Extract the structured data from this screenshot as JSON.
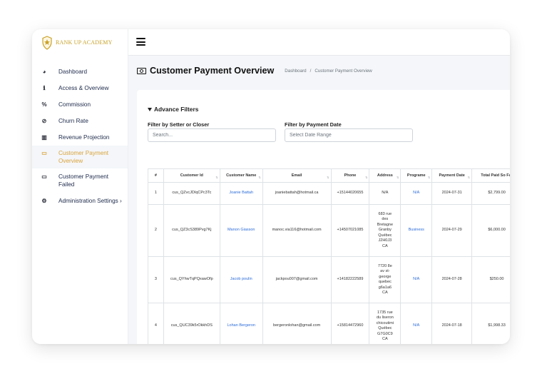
{
  "brand": {
    "name": "RANK UP ACADEMY",
    "color": "#c9a227"
  },
  "sidebar": {
    "items": [
      {
        "label": "Dashboard",
        "icon": "tachometer-icon",
        "glyph": "◕"
      },
      {
        "label": "Access & Overview",
        "icon": "info-icon",
        "glyph": "ℹ"
      },
      {
        "label": "Commission",
        "icon": "percent-icon",
        "glyph": "%"
      },
      {
        "label": "Churn Rate",
        "icon": "ban-icon",
        "glyph": "⊘"
      },
      {
        "label": "Revenue Projection",
        "icon": "bar-chart-icon",
        "glyph": "▥"
      },
      {
        "label": "Customer Payment Overview",
        "icon": "money-bill-icon",
        "glyph": "▭",
        "active": true
      },
      {
        "label": "Customer Payment Failed",
        "icon": "money-bill-icon",
        "glyph": "▭"
      },
      {
        "label": "Administration Settings ›",
        "icon": "cogs-icon",
        "glyph": "⚙"
      }
    ]
  },
  "header": {
    "title": "Customer Payment Overview",
    "breadcrumb": [
      "Dashboard",
      "/",
      "Customer Payment Overview"
    ]
  },
  "filters": {
    "title": "Advance Filters",
    "setter_label": "Filter by Setter or Closer",
    "setter_placeholder": "Search...",
    "date_label": "Filter by Payment Date",
    "date_placeholder": "Select Date Range"
  },
  "table": {
    "columns": [
      "#",
      "Customer Id",
      "Customer Name",
      "Email",
      "Phone",
      "Address",
      "Programe",
      "Payment Date",
      "Total Paid So Far"
    ],
    "rows": [
      {
        "n": "1",
        "id": "cus_QZvcJDIqCPc3Tc",
        "name": "Joanie Battah",
        "email": "joaniebattah@hotmail.ca",
        "phone": "+15144020655",
        "address": "N/A",
        "program": "N/A",
        "date": "2024-07-31",
        "total": "$2,799.00"
      },
      {
        "n": "2",
        "id": "cus_QZ3cS389Pvg7Kj",
        "name": "Manon Giasson",
        "email": "manoc.via116@hotmail.com",
        "phone": "+14507021085",
        "address": "683 rue\ndes\nBretagne\nGranby\nQuébec\nJ2H0J3\nCA",
        "program": "Business",
        "date": "2024-07-29",
        "total": "$6,000.00"
      },
      {
        "n": "3",
        "id": "cus_QYhwTqPQxawOfp",
        "name": "Jacob poulin",
        "email": "jackpou007@gmail.com",
        "phone": "+14182222589",
        "address": "7720 8e\nav st-\ngeorge\nquebec\ng6a1a6\nCA",
        "program": "N/A",
        "date": "2024-07-28",
        "total": "$250.00"
      },
      {
        "n": "4",
        "id": "cus_QUC39k5rOkkhDS",
        "name": "Lohan Bergeron",
        "email": "bergeronlohan@gmail.com",
        "phone": "+15814472960",
        "address": "1735 rue\ndu liseron\nchicoutimi\nQuébec\nG7G0C9\nCA",
        "program": "N/A",
        "date": "2024-07-18",
        "total": "$1,998.33"
      }
    ]
  },
  "colors": {
    "accent": "#d9a33c",
    "link": "#2c6cd8",
    "page_bg": "#f4f6f9"
  }
}
